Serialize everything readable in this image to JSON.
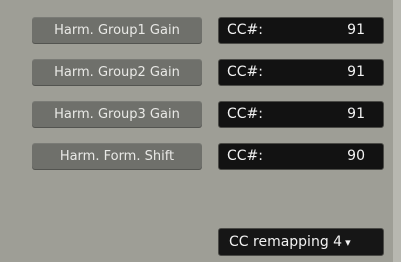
{
  "rows": [
    {
      "label": "Harm. Group1 Gain",
      "cc_label": "CC#:",
      "cc_value": "91"
    },
    {
      "label": "Harm. Group2 Gain",
      "cc_label": "CC#:",
      "cc_value": "91"
    },
    {
      "label": "Harm. Group3 Gain",
      "cc_label": "CC#:",
      "cc_value": "91"
    },
    {
      "label": "Harm. Form. Shift",
      "cc_label": "CC#:",
      "cc_value": "90"
    }
  ],
  "remap_button": {
    "label": "CC remapping 4",
    "arrow": "▾"
  },
  "colors": {
    "background": "#9e9e96",
    "label_bg": "#6f706b",
    "field_bg": "#121212",
    "text": "#f2f2f2"
  }
}
